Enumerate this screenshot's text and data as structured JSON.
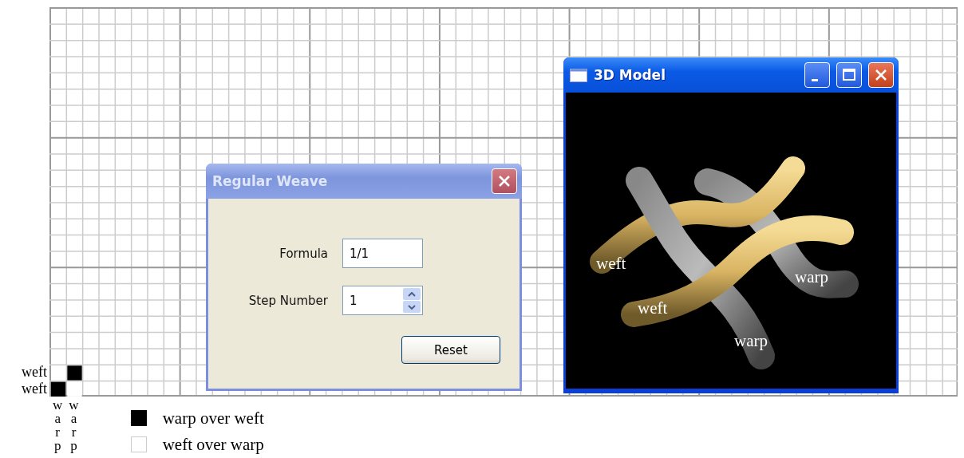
{
  "draft": {
    "rows": [
      {
        "label": "weft",
        "cells": [
          false,
          true
        ]
      },
      {
        "label": "weft",
        "cells": [
          true,
          false
        ]
      }
    ],
    "columns": [
      {
        "label": "warp"
      },
      {
        "label": "warp"
      }
    ]
  },
  "legend": [
    {
      "label": "warp over weft",
      "filled": true
    },
    {
      "label": "weft over warp",
      "filled": false
    }
  ],
  "dialog": {
    "title": "Regular Weave",
    "active": false,
    "fields": [
      {
        "kind": "text",
        "label": "Formula",
        "value": "1/1"
      },
      {
        "kind": "spinner",
        "label": "Step Number",
        "value": "1"
      }
    ],
    "buttons": [
      "Reset"
    ]
  },
  "model_window": {
    "title": "3D Model",
    "active": true,
    "labels": [
      {
        "text": "weft"
      },
      {
        "text": "warp"
      },
      {
        "text": "weft"
      },
      {
        "text": "warp"
      }
    ]
  }
}
